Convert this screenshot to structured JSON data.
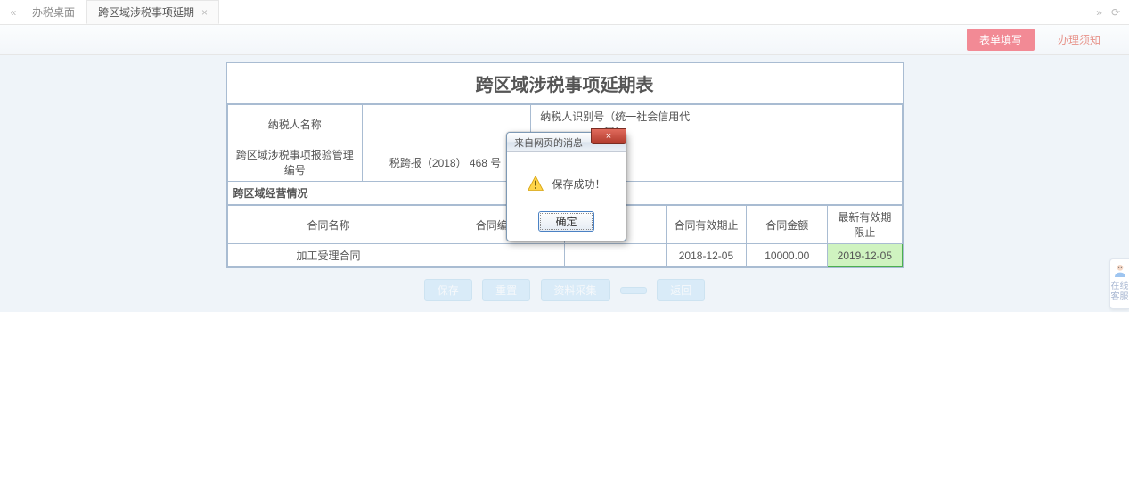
{
  "tabs": {
    "nav_prev_icon": "«",
    "nav_next_icon": "»",
    "refresh_icon": "⟳",
    "items": [
      {
        "label": "办税桌面",
        "closable": false,
        "active": false
      },
      {
        "label": "跨区域涉税事项延期",
        "closable": true,
        "active": true
      }
    ]
  },
  "subtabs": {
    "active_label": "表单填写",
    "inactive_label": "办理须知"
  },
  "form": {
    "title": "跨区域涉税事项延期表",
    "labels": {
      "taxpayer_name": "纳税人名称",
      "taxpayer_id": "纳税人识别号（统一社会信用代码）",
      "record_no": "跨区域涉税事项报验管理编号",
      "section": "跨区域经营情况"
    },
    "values": {
      "taxpayer_name": "",
      "taxpayer_id": "",
      "record_no": "税跨报（2018） 468 号"
    },
    "columns": {
      "contract_name": "合同名称",
      "contract_no": "合同编号",
      "valid_until": "合同有效期止",
      "amount": "合同金额",
      "new_valid_until": "最新有效期限止"
    },
    "row": {
      "contract_name": "加工受理合同",
      "contract_no": "",
      "valid_until": "2018-12-05",
      "amount": "10000.00",
      "new_valid_until": "2019-12-05"
    }
  },
  "actions": {
    "save": "保存",
    "reset": "重置",
    "print": "资料采集",
    "blank": "",
    "back": "返回"
  },
  "dialog": {
    "title": "来自网页的消息",
    "close_label": "×",
    "message": "保存成功！",
    "ok": "确定"
  },
  "side_help": {
    "label_line1": "在线",
    "label_line2": "客服"
  }
}
